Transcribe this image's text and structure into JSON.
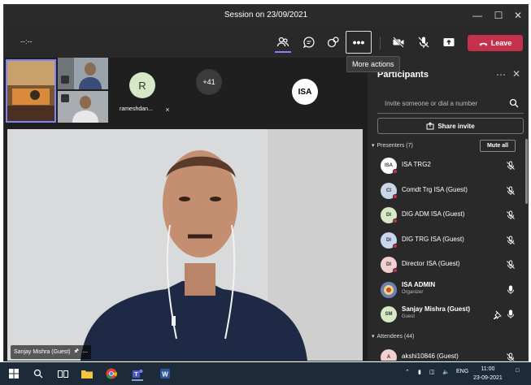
{
  "window": {
    "title": "Session on 23/09/2021"
  },
  "toolbar": {
    "timer": "--:--",
    "leave_label": "Leave",
    "more_tooltip": "More actions",
    "more_label": "•••"
  },
  "gallery": {
    "tile_r_initial": "R",
    "tile_r_name": "rameshdan...",
    "overflow_count": "+41",
    "isa_initials": "ISA"
  },
  "main_video": {
    "name": "Sanjay Mishra (Guest)"
  },
  "panel": {
    "title": "Participants",
    "invite_placeholder": "Invite someone or dial a number",
    "share_label": "Share invite",
    "presenters_header": "Presenters (7)",
    "mute_all_label": "Mute all",
    "attendees_header": "Attendees (44)",
    "presenters": [
      {
        "initials": "ISA",
        "name": "ISA TRG2",
        "avatar_color": "#ffffff"
      },
      {
        "initials": "CI",
        "name": "Comdt Trg ISA (Guest)",
        "avatar_color": "#c8d6e6"
      },
      {
        "initials": "DI",
        "name": "DIG ADM ISA (Guest)",
        "avatar_color": "#d6e8c6"
      },
      {
        "initials": "DI",
        "name": "DIG TRG ISA (Guest)",
        "avatar_color": "#c8d6f0"
      },
      {
        "initials": "DI",
        "name": "Director ISA (Guest)",
        "avatar_color": "#f0d0d0"
      },
      {
        "initials": "",
        "name": "ISA ADMIN",
        "sub": "Organizer",
        "avatar_color": "#6b7fb0"
      },
      {
        "initials": "SM",
        "name": "Sanjay Mishra (Guest)",
        "sub": "Guest",
        "avatar_color": "#d6e8c6"
      }
    ],
    "attendees": [
      {
        "initials": "A",
        "name": "akshi10846 (Guest)",
        "avatar_color": "#f0d0d0"
      }
    ]
  },
  "taskbar": {
    "language": "ENG",
    "time": "11:00",
    "date": "23-09-2021"
  },
  "colors": {
    "accent": "#7f85f5",
    "leave": "#c4314b",
    "background": "#1f1f1f",
    "panel": "#292929"
  }
}
